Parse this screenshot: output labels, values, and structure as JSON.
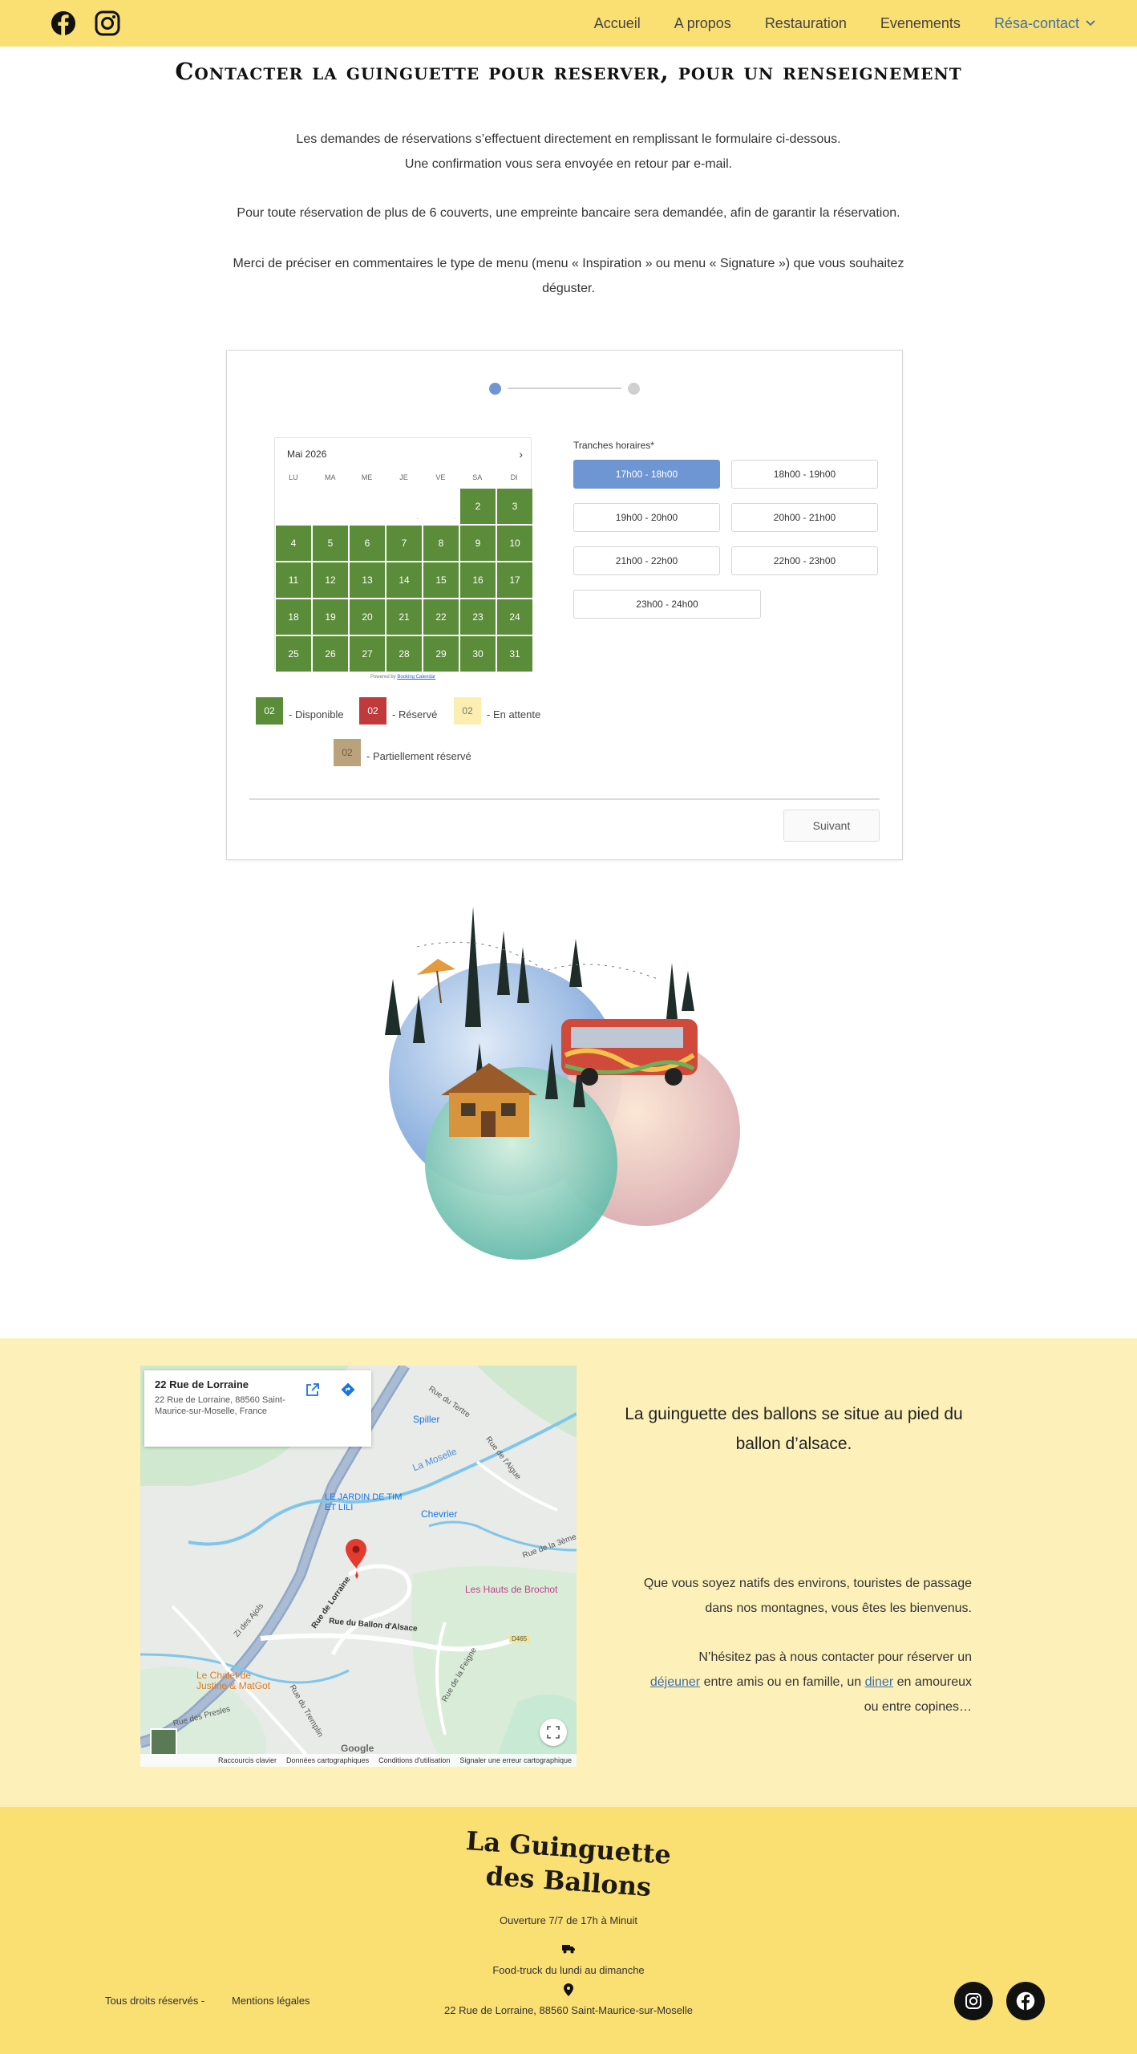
{
  "header": {
    "nav": [
      "Accueil",
      "A propos",
      "Restauration",
      "Evenements",
      "Résa-contact"
    ],
    "social": [
      "facebook-icon",
      "instagram-icon"
    ]
  },
  "page": {
    "title": "Contacter la guinguette pour reserver, pour un renseignement",
    "intro": [
      "Les demandes de réservations s’effectuent directement en remplissant le formulaire ci-dessous.",
      "Une confirmation vous sera envoyée en retour par e-mail.",
      "Pour toute réservation de plus de 6 couverts, une empreinte bancaire sera demandée, afin de garantir la réservation.",
      "Merci de préciser en commentaires le type de menu (menu « Inspiration » ou menu « Signature ») que vous souhaitez",
      "déguster."
    ]
  },
  "form": {
    "calendar": {
      "month": "Mai 2026",
      "next_icon": "chevron-right-icon",
      "weekdays": [
        "LU",
        "MA",
        "ME",
        "JE",
        "VE",
        "SA",
        "DI"
      ],
      "leading_blank": [
        ".",
        "."
      ],
      "days": [
        "2",
        "3",
        "4",
        "5",
        "6",
        "7",
        "8",
        "9",
        "10",
        "11",
        "12",
        "13",
        "14",
        "15",
        "16",
        "17",
        "18",
        "19",
        "20",
        "21",
        "22",
        "23",
        "24",
        "25",
        "26",
        "27",
        "28",
        "29",
        "30",
        "31"
      ],
      "powered_by": "Powered by",
      "powered_link": "Booking Calendar"
    },
    "legend": [
      {
        "sample": "02",
        "label": "- Disponible",
        "color": "#5a8c39"
      },
      {
        "sample": "02",
        "label": "- Réservé",
        "color": "#c0393b"
      },
      {
        "sample": "02",
        "label": "- En attente",
        "color": "#fbeeb0"
      },
      {
        "sample": "02",
        "label": "- Partiellement réservé",
        "color": "#b9a27c"
      }
    ],
    "slots_label": "Tranches horaires*",
    "slots": [
      "17h00 - 18h00",
      "18h00 - 19h00",
      "19h00 - 20h00",
      "20h00 - 21h00",
      "21h00 - 22h00",
      "22h00 - 23h00",
      "23h00 - 24h00"
    ],
    "selected_slot": "17h00 - 18h00",
    "next_button": "Suivant",
    "colors": {
      "accent": "#6e96d3",
      "available": "#5a8c39"
    }
  },
  "map": {
    "info_title": "22 Rue de Lorraine",
    "info_address": "22 Rue de Lorraine, 88560 Saint-Maurice-sur-Moselle, France",
    "places": [
      "La Moselle",
      "LE JARDIN DE TIM ET LILI",
      "Chevrier",
      "Spiller",
      "Les Hauts de Brochot",
      "Le Chalet de Justine & MatGot"
    ],
    "roads": [
      "Rue du Tertre",
      "Rue de l'Aigue",
      "Rue de la 3ème",
      "Rue de Lorraine",
      "Rue du Ballon d'Alsace",
      "Zi des Ajols",
      "Rue du Tremplin",
      "Rue des Presles",
      "D465",
      "Rue de la Feigne"
    ],
    "brand": "Google",
    "footer_links": [
      "Raccourcis clavier",
      "Données cartographiques",
      "Conditions d'utilisation",
      "Signaler une erreur cartographique"
    ]
  },
  "about": {
    "heading": "La guinguette des ballons se situe au pied du ballon d’alsace.",
    "p1": [
      "Que vous soyez natifs des environs, touristes de passage",
      "dans nos montagnes, vous êtes les bienvenus."
    ],
    "p2_line1": "N’hésitez pas à nous contacter pour réserver un",
    "p2_link1": "déjeuner",
    "p2_mid": " entre amis ou en famille, un ",
    "p2_link2": "diner",
    "p2_end": " en amoureux",
    "p2_line3": "ou entre copines…"
  },
  "footer": {
    "logo_line1": "La Guinguette",
    "logo_line2": "des Ballons",
    "hours": "Ouverture 7/7 de 17h à Minuit",
    "truck_icon": "truck-icon",
    "foodtruck": "Food-truck du lundi au dimanche",
    "pin_icon": "map-pin-icon",
    "address": "22 Rue de Lorraine, 88560 Saint-Maurice-sur-Moselle",
    "rights": "Tous droits réservés -",
    "legal": "Mentions légales",
    "social": [
      "instagram-icon",
      "facebook-icon"
    ]
  }
}
